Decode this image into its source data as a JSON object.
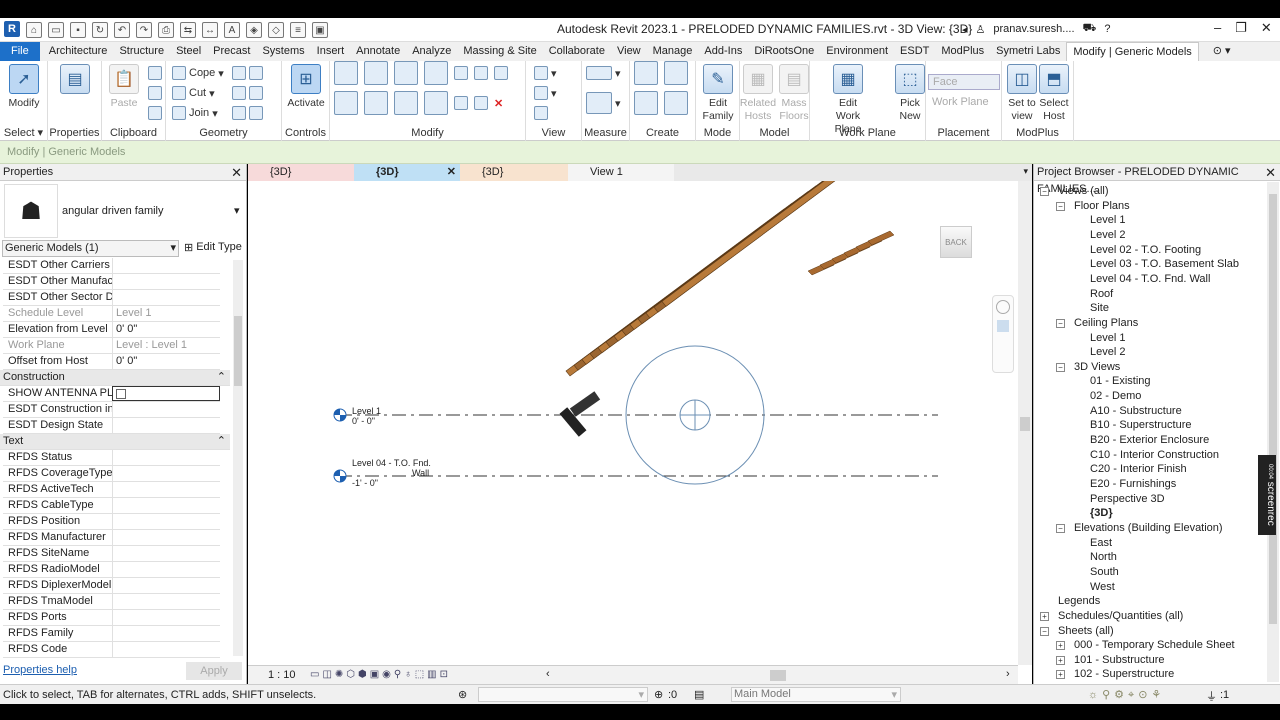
{
  "app": {
    "title": "Autodesk Revit 2023.1 - PRELODED DYNAMIC FAMILIES.rvt - 3D View: {3D}",
    "user": "pranav.suresh....",
    "logo": "R"
  },
  "tabs": [
    "File",
    "Architecture",
    "Structure",
    "Steel",
    "Precast",
    "Systems",
    "Insert",
    "Annotate",
    "Analyze",
    "Massing & Site",
    "Collaborate",
    "View",
    "Manage",
    "Add-Ins",
    "DiRootsOne",
    "Environment",
    "ESDT",
    "ModPlus",
    "Symetri Labs",
    "Modify | Generic Models"
  ],
  "ribbon": {
    "modify": "Modify",
    "select": "Select",
    "properties": "Properties",
    "clipboard": "Clipboard",
    "paste": "Paste",
    "cope": "Cope",
    "cut": "Cut",
    "join": "Join",
    "geometry": "Geometry",
    "activate": "Activate",
    "controls": "Controls",
    "modify_panel": "Modify",
    "view": "View",
    "measure": "Measure",
    "create": "Create",
    "edit_family": "Edit Family",
    "mode": "Mode",
    "related_hosts": "Related Hosts",
    "mass_floors": "Mass Floors",
    "model": "Model",
    "edit_work_plane": "Edit Work Plane",
    "work_plane": "Work Plane",
    "pick_new": "Pick New",
    "face": "Face",
    "work_plane_small": "Work Plane",
    "placement": "Placement",
    "set_to_view": "Set to view",
    "select_host": "Select Host",
    "modplus": "ModPlus"
  },
  "context_bar": "Modify | Generic Models",
  "properties": {
    "title": "Properties",
    "family_name": "angular driven family",
    "selector": "Generic Models (1)",
    "edit_type": "Edit Type",
    "help": "Properties help",
    "apply": "Apply",
    "rows": [
      {
        "k": "ESDT Other Carriers ...",
        "v": ""
      },
      {
        "k": "ESDT Other Manufact...",
        "v": ""
      },
      {
        "k": "ESDT Other Sector Di...",
        "v": ""
      },
      {
        "k": "Schedule Level",
        "v": "Level 1"
      },
      {
        "k": "Elevation from Level",
        "v": "0'  0\""
      },
      {
        "k": "Work Plane",
        "v": "Level : Level 1"
      },
      {
        "k": "Offset from Host",
        "v": "0'  0\""
      },
      {
        "k": "Construction",
        "v": ""
      },
      {
        "k": "SHOW ANTENNA PL...",
        "v": ""
      },
      {
        "k": "ESDT Construction int...",
        "v": ""
      },
      {
        "k": "ESDT Design State",
        "v": ""
      },
      {
        "k": "Text",
        "v": ""
      },
      {
        "k": "RFDS Status",
        "v": ""
      },
      {
        "k": "RFDS CoverageType",
        "v": ""
      },
      {
        "k": "RFDS ActiveTech",
        "v": ""
      },
      {
        "k": "RFDS CableType",
        "v": ""
      },
      {
        "k": "RFDS Position",
        "v": ""
      },
      {
        "k": "RFDS Manufacturer",
        "v": ""
      },
      {
        "k": "RFDS SiteName",
        "v": ""
      },
      {
        "k": "RFDS RadioModel",
        "v": ""
      },
      {
        "k": "RFDS DiplexerModel",
        "v": ""
      },
      {
        "k": "RFDS TmaModel",
        "v": ""
      },
      {
        "k": "RFDS Ports",
        "v": ""
      },
      {
        "k": "RFDS Family",
        "v": ""
      },
      {
        "k": "RFDS Code",
        "v": ""
      }
    ]
  },
  "view_tabs": [
    "{3D}",
    "{3D}",
    "{3D}",
    "View 1"
  ],
  "viewport": {
    "level1": "Level 1",
    "level1_elev": "0' - 0\"",
    "level04": "Level 04 - T.O. Fnd.",
    "level04b": "Wall",
    "level04_elev": "-1' - 0\"",
    "viewcube": "BACK",
    "scale": "1 : 10",
    "watermark": "screenrec",
    "watermark_time": "00:04"
  },
  "browser": {
    "title": "Project Browser - PRELODED DYNAMIC FAMILIES....",
    "items": [
      "Views (all)",
      "Floor Plans",
      "Level 1",
      "Level 2",
      "Level 02 - T.O. Footing",
      "Level 03 - T.O. Basement Slab",
      "Level 04 - T.O. Fnd. Wall",
      "Roof",
      "Site",
      "Ceiling Plans",
      "Level 1",
      "Level 2",
      "3D Views",
      "01 - Existing",
      "02 - Demo",
      "A10 - Substructure",
      "B10 - Superstructure",
      "B20 - Exterior Enclosure",
      "C10 - Interior Construction",
      "C20 - Interior Finish",
      "E20 - Furnishings",
      "Perspective 3D",
      "{3D}",
      "Elevations (Building Elevation)",
      "East",
      "North",
      "South",
      "West",
      "Legends",
      "Schedules/Quantities (all)",
      "Sheets (all)",
      "000 - Temporary Schedule Sheet",
      "101 - Substructure",
      "102 - Superstructure"
    ]
  },
  "status": {
    "hint": "Click to select, TAB for alternates, CTRL adds, SHIFT unselects.",
    "zero": ":0",
    "model": "Main Model",
    "filter": ":1"
  }
}
